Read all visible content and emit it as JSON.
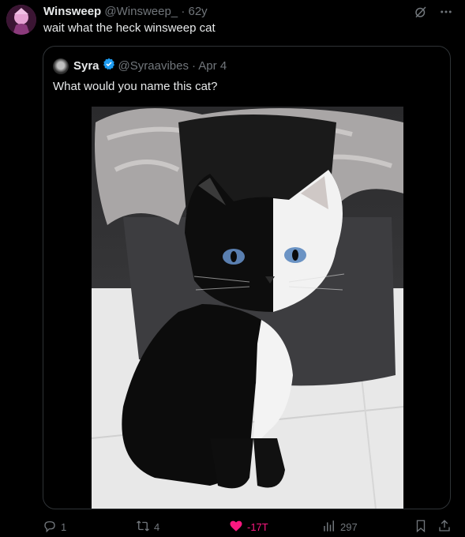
{
  "post": {
    "author_name": "Winsweep",
    "author_handle": "@Winsweep_",
    "time": "· 62y",
    "text": "wait what the heck winsweep cat"
  },
  "quote": {
    "author_name": "Syra",
    "author_handle": "@Syraavibes",
    "time": "· Apr 4",
    "text": "What would you name this cat?"
  },
  "actions": {
    "replies": "1",
    "reposts": "4",
    "likes": "-17T",
    "views": "297"
  },
  "colors": {
    "background": "#000000",
    "text": "#e7e9ea",
    "muted": "#71767b",
    "like": "#f91880",
    "verified": "#1d9bf0"
  },
  "icons": [
    "grok-icon",
    "more-icon",
    "verified-badge-icon",
    "reply-icon",
    "repost-icon",
    "heart-icon",
    "views-icon",
    "bookmark-icon",
    "share-icon"
  ]
}
